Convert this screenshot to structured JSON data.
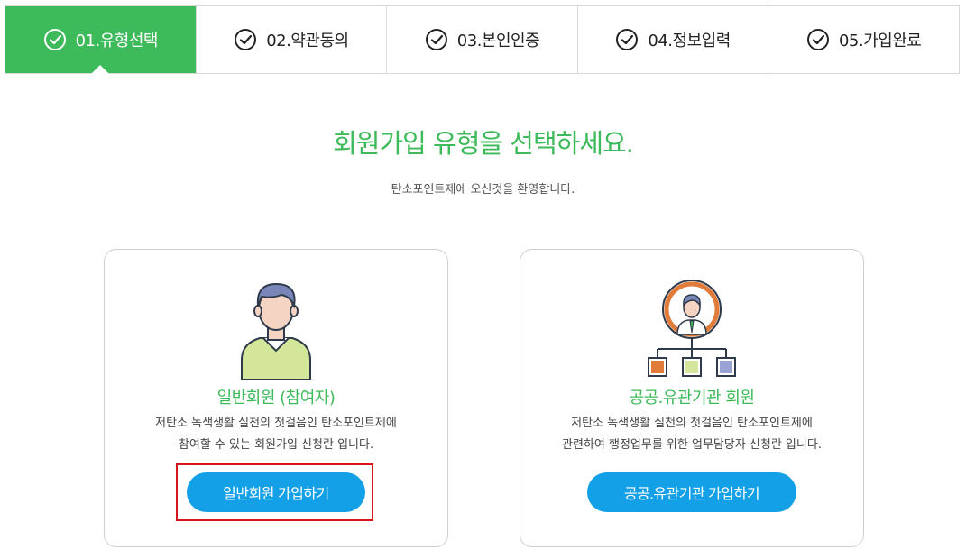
{
  "steps": [
    {
      "label": "01.유형선택",
      "active": true
    },
    {
      "label": "02.약관동의",
      "active": false
    },
    {
      "label": "03.본인인증",
      "active": false
    },
    {
      "label": "04.정보입력",
      "active": false
    },
    {
      "label": "05.가입완료",
      "active": false
    }
  ],
  "heading": "회원가입 유형을 선택하세요.",
  "subheading": "탄소포인트제에 오신것을 환영합니다.",
  "cards": {
    "general": {
      "title": "일반회원 (참여자)",
      "desc_line1": "저탄소 녹색생활 실천의 첫걸음인 탄소포인트제에",
      "desc_line2": "참여할 수 있는 회원가입 신청란 입니다.",
      "button": "일반회원 가입하기",
      "icon": "person-icon"
    },
    "public": {
      "title": "공공.유관기관 회원",
      "desc_line1": "저탄소 녹색생활 실천의 첫걸음인 탄소포인트제에",
      "desc_line2": "관련하여 행정업무를 위한 업무담당자 신청란 입니다.",
      "button": "공공.유관기관 가입하기",
      "icon": "org-chart-icon"
    }
  },
  "colors": {
    "accent": "#3dba5a",
    "button": "#14a0e6",
    "highlight": "#d8141b"
  }
}
